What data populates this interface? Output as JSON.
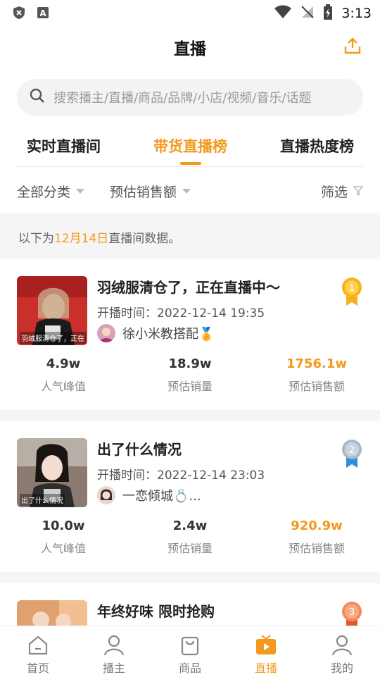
{
  "status_bar": {
    "time": "3:13"
  },
  "header": {
    "title": "直播"
  },
  "search": {
    "placeholder": "搜索播主/直播/商品/品牌/小店/视频/音乐/话题"
  },
  "tabs": [
    "实时直播间",
    "带货直播榜",
    "直播热度榜"
  ],
  "active_tab": 1,
  "filters": {
    "category": "全部分类",
    "sort": "预估销售额",
    "screen": "筛选"
  },
  "notice": {
    "prefix": "以下为",
    "date": "12月14日",
    "suffix": "直播间数据。"
  },
  "items": [
    {
      "rank": "1",
      "title": "羽绒服清仓了，正在直播中～",
      "thumb_caption": "羽绒服清仓了，正在",
      "start_label": "开播时间：",
      "start_time": "2022-12-14 19:35",
      "anchor": "徐小米教搭配🏅",
      "stats": [
        {
          "value": "4.9w",
          "label": "人气峰值"
        },
        {
          "value": "18.9w",
          "label": "预估销量"
        },
        {
          "value": "1756.1w",
          "label": "预估销售额"
        }
      ]
    },
    {
      "rank": "2",
      "title": "出了什么情况",
      "thumb_caption": "出了什么情况",
      "start_label": "开播时间：",
      "start_time": "2022-12-14 23:03",
      "anchor": "一恋倾城💍...",
      "stats": [
        {
          "value": "10.0w",
          "label": "人气峰值"
        },
        {
          "value": "2.4w",
          "label": "预估销量"
        },
        {
          "value": "920.9w",
          "label": "预估销售额"
        }
      ]
    },
    {
      "rank": "3",
      "title": "年终好味 限时抢购",
      "thumb_caption": "",
      "start_label": "",
      "start_time": "",
      "anchor": "",
      "stats": []
    }
  ],
  "nav": [
    {
      "label": "首页",
      "icon": "home-icon"
    },
    {
      "label": "播主",
      "icon": "user-icon"
    },
    {
      "label": "商品",
      "icon": "bag-icon"
    },
    {
      "label": "直播",
      "icon": "tv-icon"
    },
    {
      "label": "我的",
      "icon": "profile-icon"
    }
  ],
  "active_nav": 3,
  "colors": {
    "accent": "#f39a1e",
    "gold": "#f5b21c",
    "silver": "#aab8c8",
    "bronze": "#f08b5f"
  }
}
